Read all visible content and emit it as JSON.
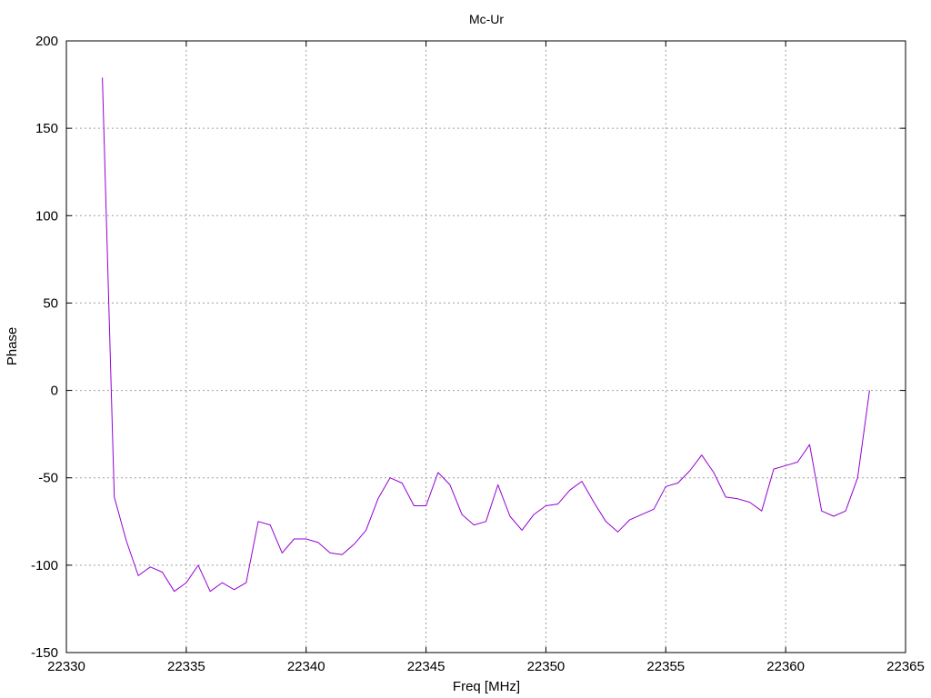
{
  "chart_data": {
    "type": "line",
    "title": "Mc-Ur",
    "xlabel": "Freq [MHz]",
    "ylabel": "Phase",
    "xlim": [
      22330,
      22365
    ],
    "ylim": [
      -150,
      200
    ],
    "xticks": [
      22330,
      22335,
      22340,
      22345,
      22350,
      22355,
      22360,
      22365
    ],
    "yticks": [
      -150,
      -100,
      -50,
      0,
      50,
      100,
      150,
      200
    ],
    "grid": true,
    "series_color": "#9400d3",
    "series": [
      {
        "x": [
          22331.5,
          22332.0,
          22332.5,
          22333.0,
          22333.5,
          22334.0,
          22334.5,
          22335.0,
          22335.5,
          22336.0,
          22336.5,
          22337.0,
          22337.5,
          22338.0,
          22338.5,
          22339.0,
          22339.5,
          22340.0,
          22340.5,
          22341.0,
          22341.5,
          22342.0,
          22342.5,
          22343.0,
          22343.5,
          22344.0,
          22344.5,
          22345.0,
          22345.5,
          22346.0,
          22346.5,
          22347.0,
          22347.5,
          22348.0,
          22348.5,
          22349.0,
          22349.5,
          22350.0,
          22350.5,
          22351.0,
          22351.5,
          22352.0,
          22352.5,
          22353.0,
          22353.5,
          22354.0,
          22354.5,
          22355.0,
          22355.5,
          22356.0,
          22356.5,
          22357.0,
          22357.5,
          22358.0,
          22358.5,
          22359.0,
          22359.5,
          22360.0,
          22360.5,
          22361.0,
          22361.5,
          22362.0,
          22362.5,
          22363.0,
          22363.5
        ],
        "y": [
          179,
          -61,
          -86,
          -106,
          -101,
          -104,
          -115,
          -110,
          -100,
          -115,
          -110,
          -114,
          -110,
          -75,
          -77,
          -93,
          -85,
          -85,
          -87,
          -93,
          -94,
          -88,
          -80,
          -62,
          -50,
          -53,
          -66,
          -66,
          -47,
          -54,
          -71,
          -77,
          -75,
          -54,
          -72,
          -80,
          -71,
          -66,
          -65,
          -57,
          -52,
          -64,
          -75,
          -81,
          -74,
          -71,
          -68,
          -55,
          -53,
          -46,
          -37,
          -47,
          -61,
          -62,
          -64,
          -69,
          -45,
          -43,
          -41,
          -31,
          -69,
          -72,
          -69,
          -50,
          0
        ]
      }
    ]
  }
}
